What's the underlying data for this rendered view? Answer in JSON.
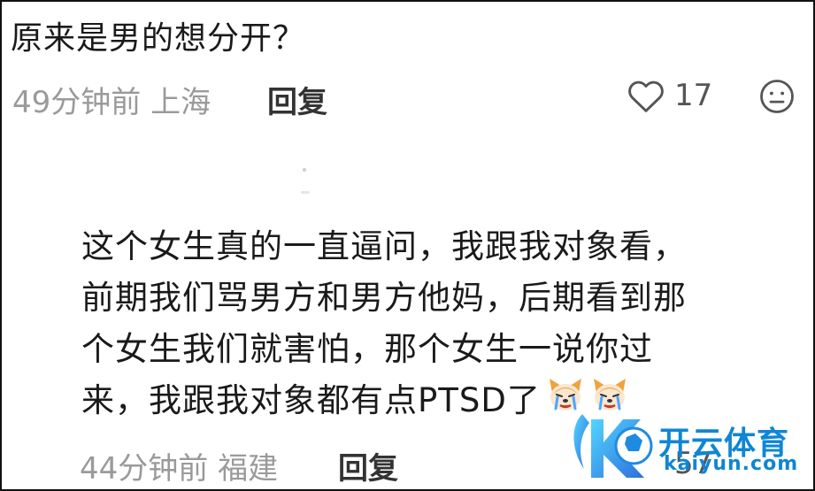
{
  "top_comment": {
    "text": "原来是男的想分开？"
  },
  "top_meta": {
    "time_location": "49分钟前 上海",
    "reply_label": "回复",
    "like_count": "17"
  },
  "reply_comment": {
    "lines": [
      "这个女生真的一直逼问，我跟我对象看，",
      "前期我们骂男方和男方他妈，后期看到那",
      "个女生我们就害怕，那个女生一说你过",
      "来，我跟我对象都有点PTSD了"
    ],
    "emojis": [
      "crying-dog-emoji",
      "crying-dog-emoji"
    ]
  },
  "bottom_meta": {
    "time_location": "44分钟前 福建",
    "reply_label": "回复",
    "like_count": "57"
  },
  "watermark": {
    "cn": "开云体育",
    "en": "kaiyun.com"
  },
  "colors": {
    "brand_blue": "#0e86d4",
    "meta_gray": "#9a9a9a",
    "text": "#1a1a1a"
  },
  "icons": [
    "heart-outline-icon",
    "neutral-face-icon"
  ]
}
